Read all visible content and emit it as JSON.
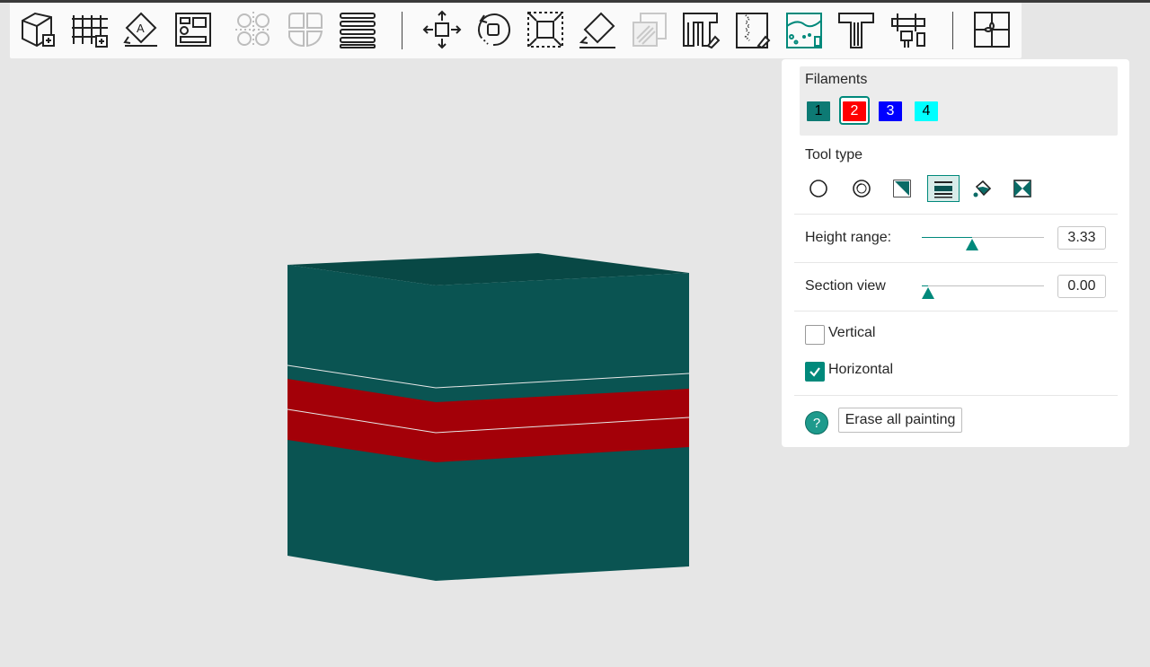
{
  "toolbar": {
    "items": [
      {
        "name": "add-object-icon"
      },
      {
        "name": "add-plate-icon"
      },
      {
        "name": "auto-orient-icon"
      },
      {
        "name": "arrange-icon"
      },
      {
        "name": "split-objects-icon"
      },
      {
        "name": "split-parts-icon"
      },
      {
        "name": "layers-icon"
      },
      {
        "name": "move-icon"
      },
      {
        "name": "rotate-icon"
      },
      {
        "name": "scale-icon"
      },
      {
        "name": "lay-on-face-icon"
      },
      {
        "name": "cut-icon"
      },
      {
        "name": "support-painting-icon"
      },
      {
        "name": "seam-painting-icon"
      },
      {
        "name": "color-painting-icon"
      },
      {
        "name": "text-icon"
      },
      {
        "name": "measure-icon"
      },
      {
        "name": "assembly-icon"
      }
    ]
  },
  "panel": {
    "filaments_title": "Filaments",
    "filaments": [
      {
        "label": "1",
        "color": "#0d7a74",
        "text_color": "#000000"
      },
      {
        "label": "2",
        "color": "#ff0000",
        "text_color": "#ffffff"
      },
      {
        "label": "3",
        "color": "#0000ff",
        "text_color": "#ffffff"
      },
      {
        "label": "4",
        "color": "#00ffff",
        "text_color": "#000000"
      }
    ],
    "selected_filament": 1,
    "tool_type_title": "Tool type",
    "tools": [
      {
        "name": "circle-tool-icon"
      },
      {
        "name": "sphere-tool-icon"
      },
      {
        "name": "triangle-tool-icon"
      },
      {
        "name": "height-range-tool-icon"
      },
      {
        "name": "fill-tool-icon"
      },
      {
        "name": "gap-fill-tool-icon"
      }
    ],
    "active_tool": 3,
    "height_range_label": "Height range:",
    "height_range_value": "3.33",
    "height_range_fraction": 0.41,
    "section_view_label": "Section view",
    "section_view_value": "0.00",
    "section_view_fraction": 0.05,
    "vertical_label": "Vertical",
    "vertical_checked": false,
    "horizontal_label": "Horizontal",
    "horizontal_checked": true,
    "help_symbol": "?",
    "erase_label": "Erase all painting"
  },
  "colors": {
    "accent": "#00897b",
    "object_main": "#0a5452",
    "paint_band": "#a30008",
    "background": "#e6e6e6"
  }
}
